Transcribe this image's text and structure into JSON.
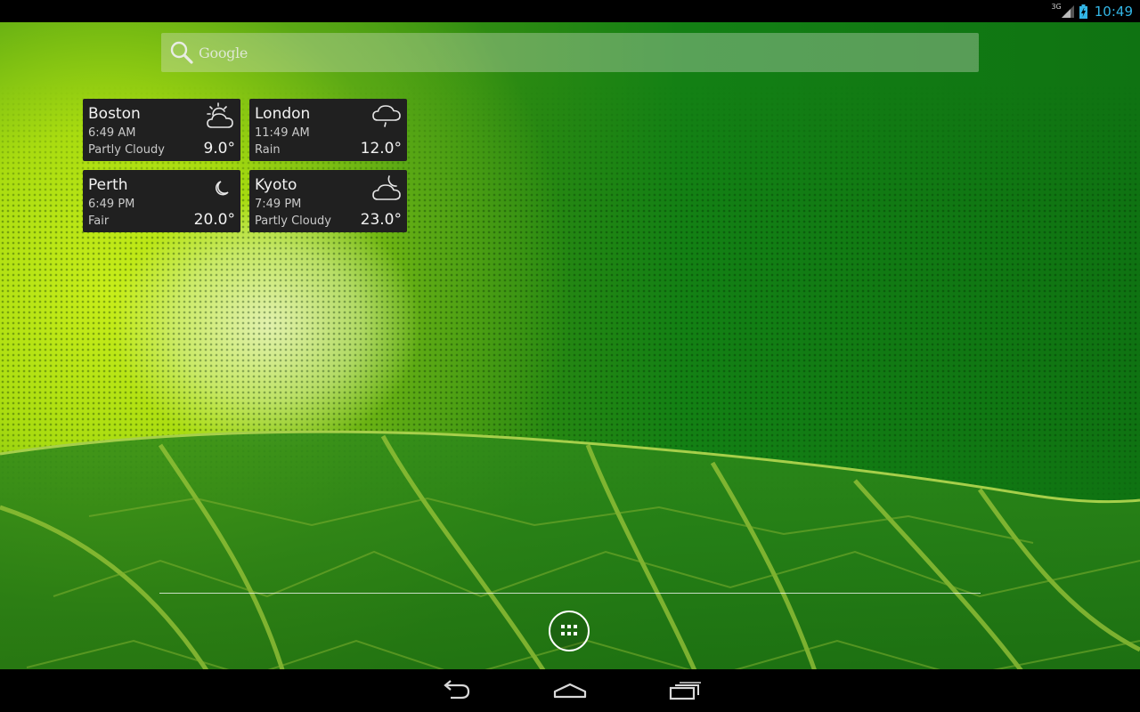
{
  "status_bar": {
    "network_type": "3G",
    "clock": "10:49",
    "icons": [
      "signal-icon",
      "battery-charging-icon"
    ]
  },
  "search": {
    "label": "Google",
    "icon": "search-icon"
  },
  "weather": [
    {
      "city": "Boston",
      "time": "6:49 AM",
      "condition": "Partly Cloudy",
      "temp": "9.0°",
      "icon": "partly-cloudy-day-icon"
    },
    {
      "city": "London",
      "time": "11:49 AM",
      "condition": "Rain",
      "temp": "12.0°",
      "icon": "rain-icon"
    },
    {
      "city": "Perth",
      "time": "6:49 PM",
      "condition": "Fair",
      "temp": "20.0°",
      "icon": "moon-icon"
    },
    {
      "city": "Kyoto",
      "time": "7:49 PM",
      "condition": "Partly Cloudy",
      "temp": "23.0°",
      "icon": "partly-cloudy-night-icon"
    }
  ],
  "dock": {
    "app_drawer_icon": "all-apps-icon"
  },
  "nav_bar": {
    "buttons": [
      "back-icon",
      "home-icon",
      "recents-icon"
    ]
  },
  "colors": {
    "clock": "#33b5e5",
    "widget_bg": "#202020",
    "wallpaper_green": "#138014",
    "wallpaper_lime": "#c8ee1a"
  }
}
